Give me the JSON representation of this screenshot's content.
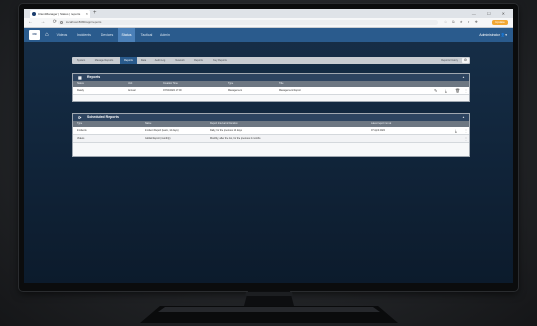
{
  "browser": {
    "tab_title": "ClientManager | Status | reports",
    "new_tab": "+",
    "window_controls": "— ☐ ✕",
    "nav": "← → ⟳ ⌂",
    "url": "localhost:8080/app/reports",
    "update_label": "Update"
  },
  "app": {
    "logo_text": "CM",
    "home_icon": "house",
    "nav_items": [
      "Videos",
      "Incidents",
      "Devices",
      "Status",
      "Tactical",
      "Admin"
    ],
    "active_nav": "Status",
    "user": "Administrator"
  },
  "subnav": {
    "tabs": [
      "System",
      "Manage Reports",
      "Reports",
      "Data",
      "Audit Log",
      "Network",
      "Reports",
      "Key Reports"
    ],
    "active_tab": "Reports",
    "history_label": "Reports history",
    "settings_icon": "gear"
  },
  "reports_panel": {
    "title": "Reports",
    "columns": [
      "Status",
      "Unit",
      "Creation Time",
      "Type",
      "Title"
    ],
    "rows": [
      [
        "Ready",
        "Annual",
        "07/04/2022 17:00",
        "Management",
        "Management Report"
      ]
    ]
  },
  "scheduled_panel": {
    "title": "Scheduled Reports",
    "columns": [
      "Type",
      "Name",
      "Report Interval & Duration",
      "Latest report run at"
    ],
    "rows": [
      [
        "Incidents",
        "Incident Report (team, 14 days)",
        "Daily, for the previous 14 days",
        "07 April 2022"
      ],
      [
        "Videos",
        "Global Report (monthly)",
        "Monthly, after the 1st, for the previous 2 months",
        ""
      ]
    ]
  },
  "colors": {
    "nav_bar": "#2a5b8d",
    "panel_header": "#2d4460",
    "active_tab": "#4b80b8"
  }
}
